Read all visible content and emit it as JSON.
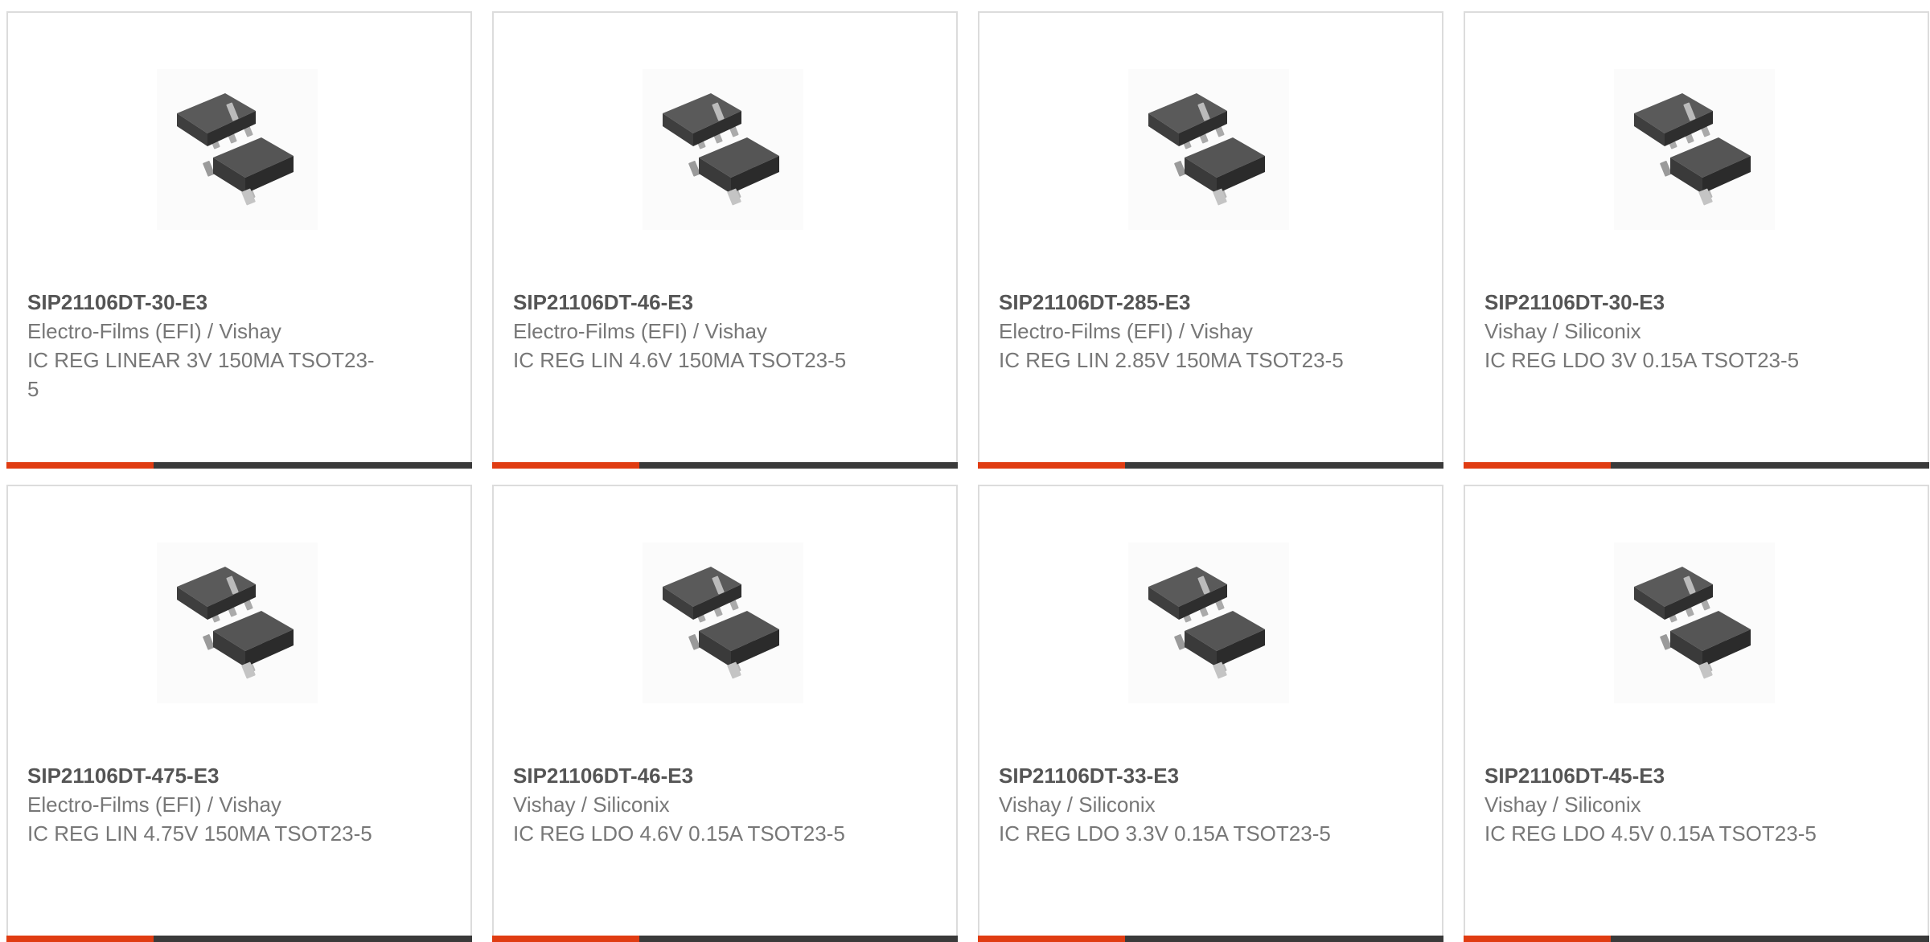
{
  "colors": {
    "accent": "#e03c12",
    "bar": "#3a3a3a",
    "border": "#dcdcdc"
  },
  "products": [
    {
      "part": "SIP21106DT-30-E3",
      "manufacturer": "Electro-Films (EFI) / Vishay",
      "description": "IC REG LINEAR 3V 150MA TSOT23-5",
      "image": "sot23-5-package-icon"
    },
    {
      "part": "SIP21106DT-46-E3",
      "manufacturer": "Electro-Films (EFI) / Vishay",
      "description": "IC REG LIN 4.6V 150MA TSOT23-5",
      "image": "sot23-5-package-icon"
    },
    {
      "part": "SIP21106DT-285-E3",
      "manufacturer": "Electro-Films (EFI) / Vishay",
      "description": "IC REG LIN 2.85V 150MA TSOT23-5",
      "image": "sot23-5-package-icon"
    },
    {
      "part": "SIP21106DT-30-E3",
      "manufacturer": "Vishay / Siliconix",
      "description": "IC REG LDO 3V 0.15A TSOT23-5",
      "image": "sot23-5-package-icon"
    },
    {
      "part": "SIP21106DT-475-E3",
      "manufacturer": "Electro-Films (EFI) / Vishay",
      "description": "IC REG LIN 4.75V 150MA TSOT23-5",
      "image": "sot23-5-package-icon"
    },
    {
      "part": "SIP21106DT-46-E3",
      "manufacturer": "Vishay / Siliconix",
      "description": "IC REG LDO 4.6V 0.15A TSOT23-5",
      "image": "sot23-5-package-icon"
    },
    {
      "part": "SIP21106DT-33-E3",
      "manufacturer": "Vishay / Siliconix",
      "description": "IC REG LDO 3.3V 0.15A TSOT23-5",
      "image": "sot23-5-package-icon"
    },
    {
      "part": "SIP21106DT-45-E3",
      "manufacturer": "Vishay / Siliconix",
      "description": "IC REG LDO 4.5V 0.15A TSOT23-5",
      "image": "sot23-5-package-icon"
    }
  ]
}
